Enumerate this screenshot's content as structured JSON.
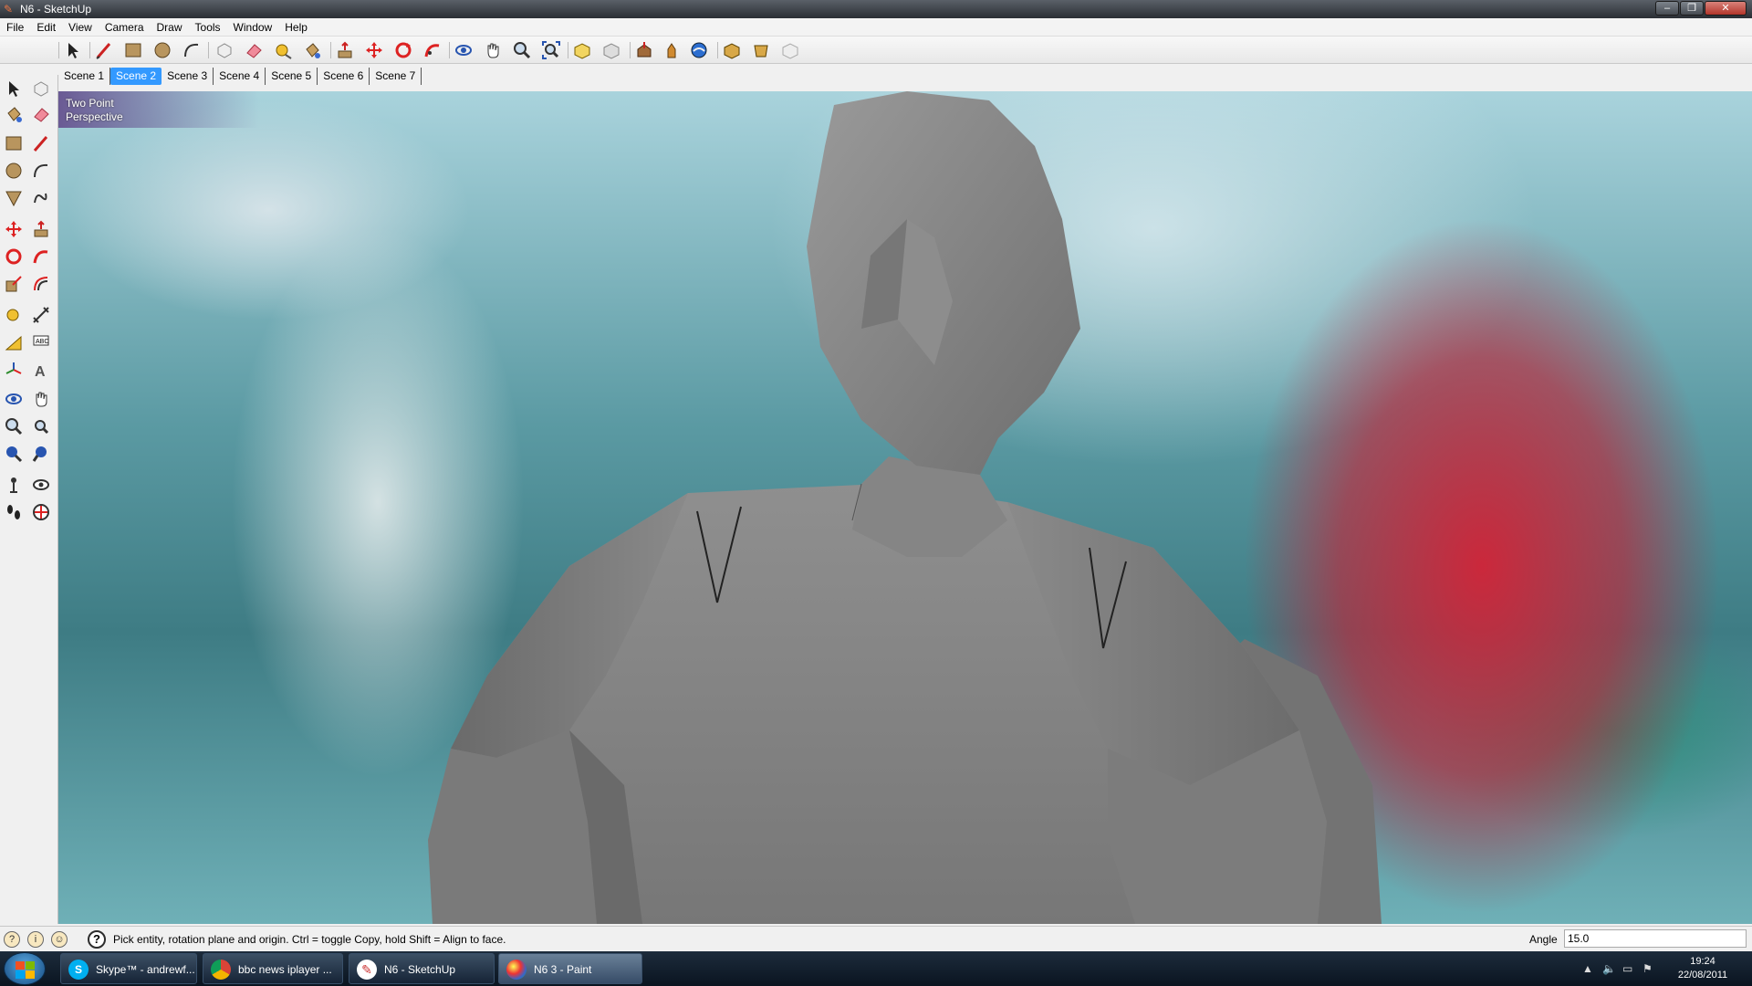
{
  "window": {
    "title": "N6 - SketchUp"
  },
  "menu": {
    "items": [
      "File",
      "Edit",
      "View",
      "Camera",
      "Draw",
      "Tools",
      "Window",
      "Help"
    ]
  },
  "scenes": {
    "tabs": [
      "Scene 1",
      "Scene 2",
      "Scene 3",
      "Scene 4",
      "Scene 5",
      "Scene 6",
      "Scene 7"
    ],
    "active": "Scene 2"
  },
  "viewport": {
    "camera_line1": "Two Point",
    "camera_line2": "Perspective"
  },
  "status": {
    "hint": "Pick entity, rotation plane and origin.  Ctrl = toggle Copy, hold Shift = Align to face.",
    "measure_label": "Angle",
    "measure_value": "15.0"
  },
  "taskbar": {
    "tasks": [
      {
        "label": "Skype™ - andrewf...",
        "icon": "skype-icon"
      },
      {
        "label": "bbc news iplayer ...",
        "icon": "chrome-icon"
      },
      {
        "label": "N6 - SketchUp",
        "icon": "sketchup-icon"
      },
      {
        "label": "N6 3 - Paint",
        "icon": "paint-icon"
      }
    ],
    "clock_time": "19:24",
    "clock_date": "22/08/2011"
  },
  "colors": {
    "accent": "#3399ff",
    "titlebar": "#2a2e34",
    "taskbar": "#0a1420",
    "model": "#8a8a8a"
  }
}
